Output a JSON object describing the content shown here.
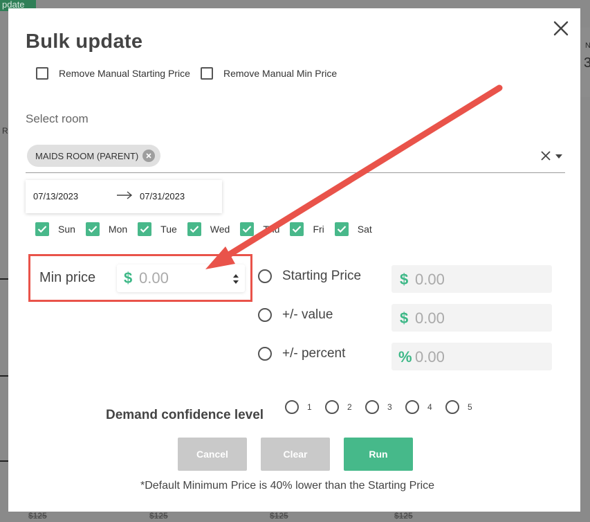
{
  "background": {
    "top_left_button": "pdate",
    "right_letter": "N",
    "right_number": "3",
    "left_letter": "R",
    "prices": [
      "$125",
      "$125",
      "$125",
      "$125"
    ]
  },
  "modal": {
    "title": "Bulk update",
    "remove_manual_starting_price_label": "Remove Manual Starting Price",
    "remove_manual_min_price_label": "Remove Manual Min Price",
    "select_room_label": "Select room",
    "selected_room": "MAIDS ROOM (PARENT)",
    "date_start": "07/13/2023",
    "date_end": "07/31/2023",
    "days": [
      {
        "label": "Sun",
        "checked": true
      },
      {
        "label": "Mon",
        "checked": true
      },
      {
        "label": "Tue",
        "checked": true
      },
      {
        "label": "Wed",
        "checked": true
      },
      {
        "label": "Thu",
        "checked": true
      },
      {
        "label": "Fri",
        "checked": true
      },
      {
        "label": "Sat",
        "checked": true
      }
    ],
    "min_price": {
      "label": "Min price",
      "currency": "$",
      "placeholder": "0.00"
    },
    "options": [
      {
        "label": "Starting Price",
        "symbol": "$",
        "placeholder": "0.00"
      },
      {
        "label": "+/- value",
        "symbol": "$",
        "placeholder": "0.00"
      },
      {
        "label": "+/- percent",
        "symbol": "%",
        "placeholder": "0.00"
      }
    ],
    "demand_confidence": {
      "label": "Demand confidence level",
      "levels": [
        "1",
        "2",
        "3",
        "4",
        "5"
      ]
    },
    "buttons": {
      "cancel": "Cancel",
      "clear": "Clear",
      "run": "Run"
    },
    "footnote": "*Default Minimum Price is 40% lower than the Starting Price"
  },
  "colors": {
    "accent": "#46b98a",
    "highlight": "#e9534a",
    "disabled": "#c9c9c9"
  }
}
